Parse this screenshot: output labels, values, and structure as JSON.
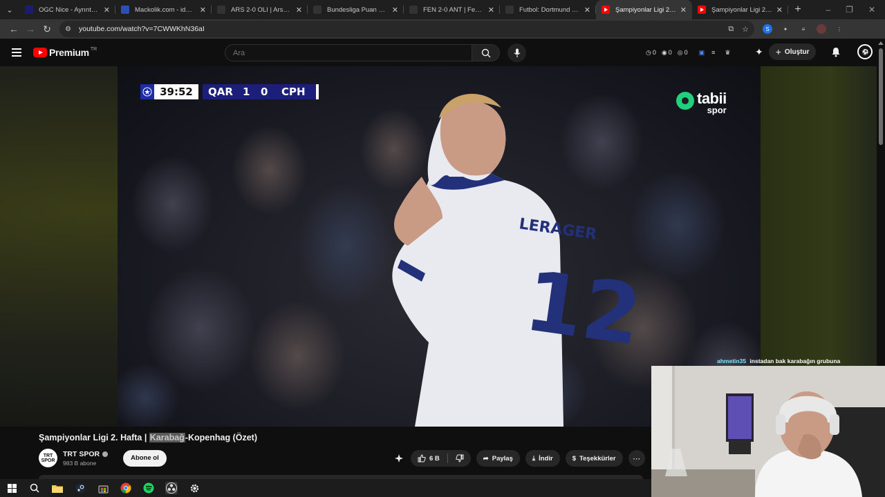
{
  "browser": {
    "tabs": [
      {
        "title": "OGC Nice - Ayrıntılı kadro",
        "favicon": "nice",
        "favicon_color": "#1b1e6e",
        "active": false
      },
      {
        "title": "Mackolik.com - iddaa,canlı",
        "favicon": "M",
        "favicon_color": "#2b4fb3",
        "active": false
      },
      {
        "title": "ARS 2-0 OLI | Arsenal - Olympiacos",
        "favicon": "C",
        "favicon_color": "#333333",
        "active": false
      },
      {
        "title": "Bundesliga Puan Durumu",
        "favicon": "G",
        "favicon_color": "#333333",
        "active": false
      },
      {
        "title": "FEN 2-0 ANT | Fenerbahçe",
        "favicon": "C",
        "favicon_color": "#333333",
        "active": false
      },
      {
        "title": "Futbol: Dortmund - kadro",
        "favicon": "G",
        "favicon_color": "#333333",
        "active": false
      },
      {
        "title": "Şampiyonlar Ligi 2. Hafta",
        "favicon": "yt",
        "favicon_color": "#ff0000",
        "active": true
      },
      {
        "title": "Şampiyonlar Ligi 2. Hafta",
        "favicon": "yt",
        "favicon_color": "#ff0000",
        "active": false
      }
    ],
    "url": "youtube.com/watch?v=7CWWKhN36aI"
  },
  "youtube": {
    "brand": "Premium",
    "region": "TR",
    "search_placeholder": "Ara",
    "counters": [
      "0",
      "0",
      "0"
    ],
    "create_label": "Oluştur"
  },
  "overlay": {
    "scorebug": {
      "time": "39:52",
      "home": "QAR",
      "home_score": "1",
      "away_score": "0",
      "away": "CPH"
    },
    "broadcaster": {
      "name": "tabii",
      "sub": "spor"
    }
  },
  "chat": {
    "user": "ahmetin35",
    "message": "instadan bak karabağın grubuna"
  },
  "video": {
    "title_before": "Şampiyonlar Ligi 2. Hafta | ",
    "title_highlight": "Karabağ",
    "title_after": "-Kopenhag (Özet)",
    "channel": "TRT SPOR",
    "channel_avatar": "TRT SPOR",
    "subscribers": "983 B abone",
    "subscribe_label": "Abone ol",
    "likes": "6 B",
    "share_label": "Paylaş",
    "download_label": "İndir",
    "thanks_label": "Teşekkürler"
  },
  "colors": {
    "accent_red": "#ff0000",
    "tabii_green": "#21d07a",
    "scorebug_blue": "#1b1f7a"
  }
}
